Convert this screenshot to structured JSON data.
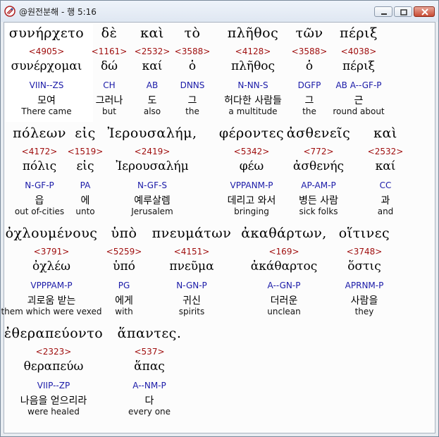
{
  "window": {
    "title": "@원전분해 - 행 5:16"
  },
  "lines": [
    {
      "words": [
        {
          "greek": "συνήρχετο",
          "strong": "<4905>",
          "lemma": "συνέρχομαι",
          "parse": "VIIN--ZS",
          "korean": "모여",
          "english": "There came"
        },
        {
          "greek": "δὲ",
          "strong": "<1161>",
          "lemma": "δώ",
          "parse": "CH",
          "korean": "그러나",
          "english": "but"
        },
        {
          "greek": "καὶ",
          "strong": "<2532>",
          "lemma": "καί",
          "parse": "AB",
          "korean": "도",
          "english": "also"
        },
        {
          "greek": "τὸ",
          "strong": "<3588>",
          "lemma": "ὁ",
          "parse": "DNNS",
          "korean": "그",
          "english": "the"
        },
        {
          "greek": "πλῆθος",
          "strong": "<4128>",
          "lemma": "πλῆθος",
          "parse": "N-NN-S",
          "korean": "허다한 사람들",
          "english": "a multitude"
        },
        {
          "greek": "τῶν",
          "strong": "<3588>",
          "lemma": "ὁ",
          "parse": "DGFP",
          "korean": "그",
          "english": "the"
        },
        {
          "greek": "πέριξ",
          "strong": "<4038>",
          "lemma": "πέριξ",
          "parse": "AB A--GF-P",
          "korean": "근",
          "english": "round about"
        }
      ]
    },
    {
      "words": [
        {
          "greek": "πόλεων",
          "strong": "<4172>",
          "lemma": "πόλις",
          "parse": "N-GF-P",
          "korean": "읍",
          "english": "out of-cities"
        },
        {
          "greek": "εἰς",
          "strong": "<1519>",
          "lemma": "εἰς",
          "parse": "PA",
          "korean": "에",
          "english": "unto"
        },
        {
          "greek": "Ἰερουσαλήμ,",
          "strong": "<2419>",
          "lemma": "Ἰερουσαλήμ",
          "parse": "N-GF-S",
          "korean": "예루살렘",
          "english": "Jerusalem"
        },
        {
          "greek": "φέροντες",
          "strong": "<5342>",
          "lemma": "φέω",
          "parse": "VPPANM-P",
          "korean": "데리고 와서",
          "english": "bringing"
        },
        {
          "greek": "ἀσθενεῖς",
          "strong": "<772>",
          "lemma": "ἀσθενής",
          "parse": "AP-AM-P",
          "korean": "병든 사람",
          "english": "sick folks"
        },
        {
          "greek": "καὶ",
          "strong": "<2532>",
          "lemma": "καί",
          "parse": "CC",
          "korean": "과",
          "english": "and"
        }
      ]
    },
    {
      "words": [
        {
          "greek": "ὀχλουμένους",
          "strong": "<3791>",
          "lemma": "ὀχλέω",
          "parse": "VPPPAM-P",
          "korean": "괴로움 받는",
          "english": "them which were vexed"
        },
        {
          "greek": "ὑπὸ",
          "strong": "<5259>",
          "lemma": "ὑπό",
          "parse": "PG",
          "korean": "에게",
          "english": "with"
        },
        {
          "greek": "πνευμάτων",
          "strong": "<4151>",
          "lemma": "πνεῦμα",
          "parse": "N-GN-P",
          "korean": "귀신",
          "english": "spirits"
        },
        {
          "greek": "ἀκαθάρτων,",
          "strong": "<169>",
          "lemma": "ἀκάθαρτος",
          "parse": "A--GN-P",
          "korean": "더러운",
          "english": "unclean"
        },
        {
          "greek": "οἵτινες",
          "strong": "<3748>",
          "lemma": "ὅστις",
          "parse": "APRNM-P",
          "korean": "사람을",
          "english": "they"
        }
      ]
    },
    {
      "words": [
        {
          "greek": "ἐθεραπεύοντο",
          "strong": "<2323>",
          "lemma": "θεραπεύω",
          "parse": "VIIP--ZP",
          "korean": "나음을 얻으리라",
          "english": "were healed"
        },
        {
          "greek": "ἅπαντες.",
          "strong": "<537>",
          "lemma": "ἅπας",
          "parse": "A--NM-P",
          "korean": "다",
          "english": "every one"
        }
      ]
    }
  ],
  "colors": {
    "strong": "#a01010",
    "parse": "#1a1aa8",
    "text": "#000000"
  },
  "icons": {
    "app": "scroll-seal-icon",
    "minimize": "minimize-icon",
    "maximize": "maximize-icon",
    "close": "close-icon"
  }
}
